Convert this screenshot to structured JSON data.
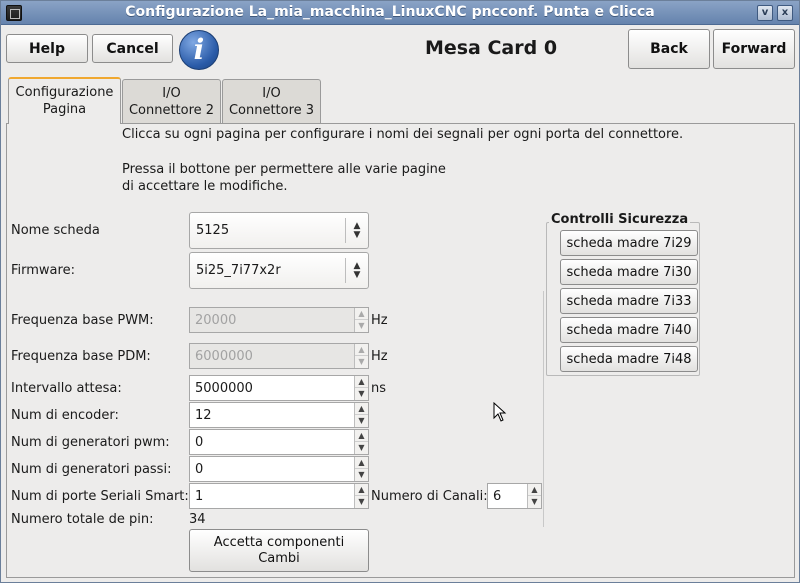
{
  "window": {
    "title": "Configurazione La_mia_macchina_LinuxCNC pncconf. Punta e Clicca",
    "min_glyph": "v",
    "close_glyph": "x"
  },
  "toolbar": {
    "help_label": "Help",
    "cancel_label": "Cancel",
    "info_glyph": "i",
    "page_title": "Mesa Card 0",
    "back_label": "Back",
    "forward_label": "Forward"
  },
  "tabs": [
    {
      "line1": "Configurazione",
      "line2": "Pagina",
      "active": true
    },
    {
      "line1": "I/O",
      "line2": "Connettore 2",
      "active": false
    },
    {
      "line1": "I/O",
      "line2": "Connettore 3",
      "active": false
    }
  ],
  "info": {
    "line1": "Clicca su ogni pagina per configurare i nomi dei segnali per ogni porta del connettore.",
    "line2": "Pressa il bottone per permettere alle varie pagine",
    "line3": "di accettare le modifiche."
  },
  "form": {
    "board_name": {
      "label": "Nome scheda",
      "value": "5125"
    },
    "firmware": {
      "label": "Firmware:",
      "value": "5i25_7i77x2r"
    },
    "pwm_base": {
      "label": "Frequenza base PWM:",
      "value": "20000",
      "unit": "Hz"
    },
    "pdm_base": {
      "label": "Frequenza base PDM:",
      "value": "6000000",
      "unit": "Hz"
    },
    "watchdog": {
      "label": "Intervallo attesa:",
      "value": "5000000",
      "unit": "ns"
    },
    "encoders": {
      "label": "Num di encoder:",
      "value": "12"
    },
    "pwm_gens": {
      "label": "Num di generatori pwm:",
      "value": "0"
    },
    "step_gens": {
      "label": "Num di generatori passi:",
      "value": "0"
    },
    "smart_serial": {
      "label": "Num di porte Seriali Smart:",
      "value": "1"
    },
    "channels": {
      "label": "Numero di Canali:",
      "value": "6"
    },
    "total_pins": {
      "label": "Numero totale de pin:",
      "value": "34"
    },
    "accept_line1": "Accetta  componenti",
    "accept_line2": "Cambi"
  },
  "safety": {
    "title": "Controlli Sicurezza",
    "boards": [
      "scheda madre 7i29",
      "scheda madre 7i30",
      "scheda madre 7i33",
      "scheda madre 7i40",
      "scheda madre 7i48"
    ]
  }
}
